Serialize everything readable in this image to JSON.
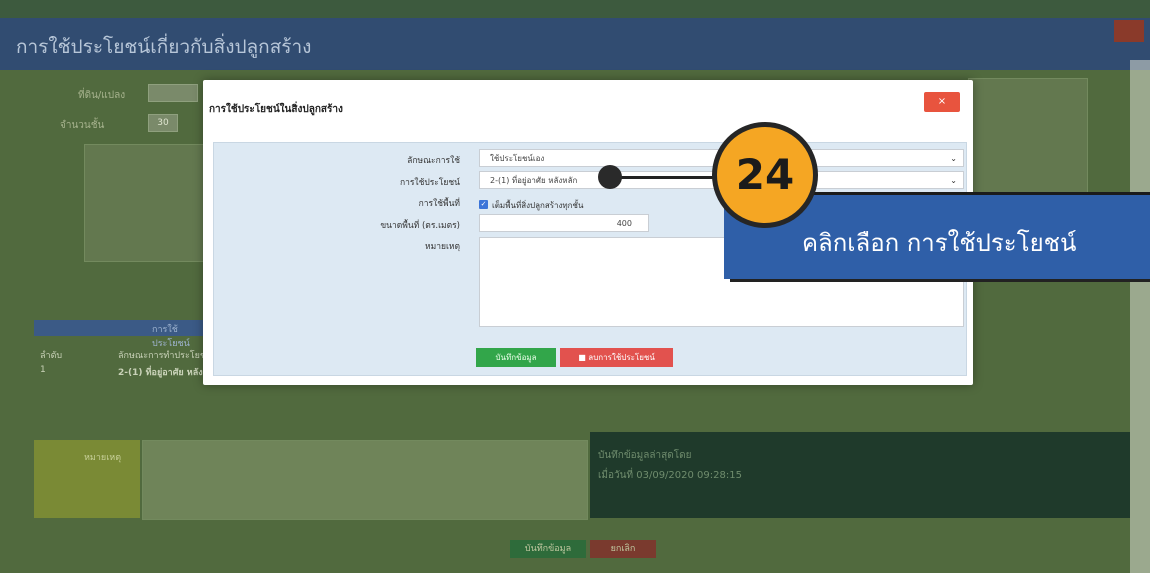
{
  "background": {
    "page_title": "การใช้ประโยชน์เกี่ยวกับสิ่งปลูกสร้าง",
    "field_1_label": "ที่ดิน/แปลง",
    "field_2_label": "จำนวนชั้น",
    "field_2_value": "30",
    "table_title": "การใช้ประโยชน์",
    "table_col_1": "ลำดับ",
    "table_col_2": "ลักษณะการทำประโยชน์",
    "table_row_no": "1",
    "table_row_text": "2-(1) ที่อยู่อาศัย หลังหลัก",
    "remark_label": "หมายเหตุ",
    "recorder_text": "บันทึกข้อมูลล่าสุดโดย",
    "recorder_date": "เมื่อวันที่ 03/09/2020 09:28:15",
    "btn_save": "บันทึกข้อมูล",
    "btn_cancel": "ยกเลิก"
  },
  "modal": {
    "title": "การใช้ประโยชน์ในสิ่งปลูกสร้าง",
    "close_label": "×",
    "fields": {
      "usage_type_label": "ลักษณะการใช้",
      "usage_type_value": "ใช้ประโยชน์เอง",
      "usage_label": "การใช้ประโยชน์",
      "usage_value": "2-(1) ที่อยู่อาศัย หลังหลัก",
      "area_usage_label": "การใช้พื้นที่",
      "area_usage_checkbox_label": "เต็มพื้นที่สิ่งปลูกสร้างทุกชั้น",
      "area_size_label": "ขนาดพื้นที่ (ตร.เมตร)",
      "area_size_value": "400",
      "remark_label": "หมายเหตุ",
      "remark_value": ""
    },
    "buttons": {
      "save": "บันทึกข้อมูล",
      "delete": "ลบการใช้ประโยชน์"
    }
  },
  "annotation": {
    "step_number": "24",
    "callout_text": "คลิกเลือก การใช้ประโยชน์",
    "badge_color": "#f5a623",
    "callout_color": "#2f5fa8"
  }
}
